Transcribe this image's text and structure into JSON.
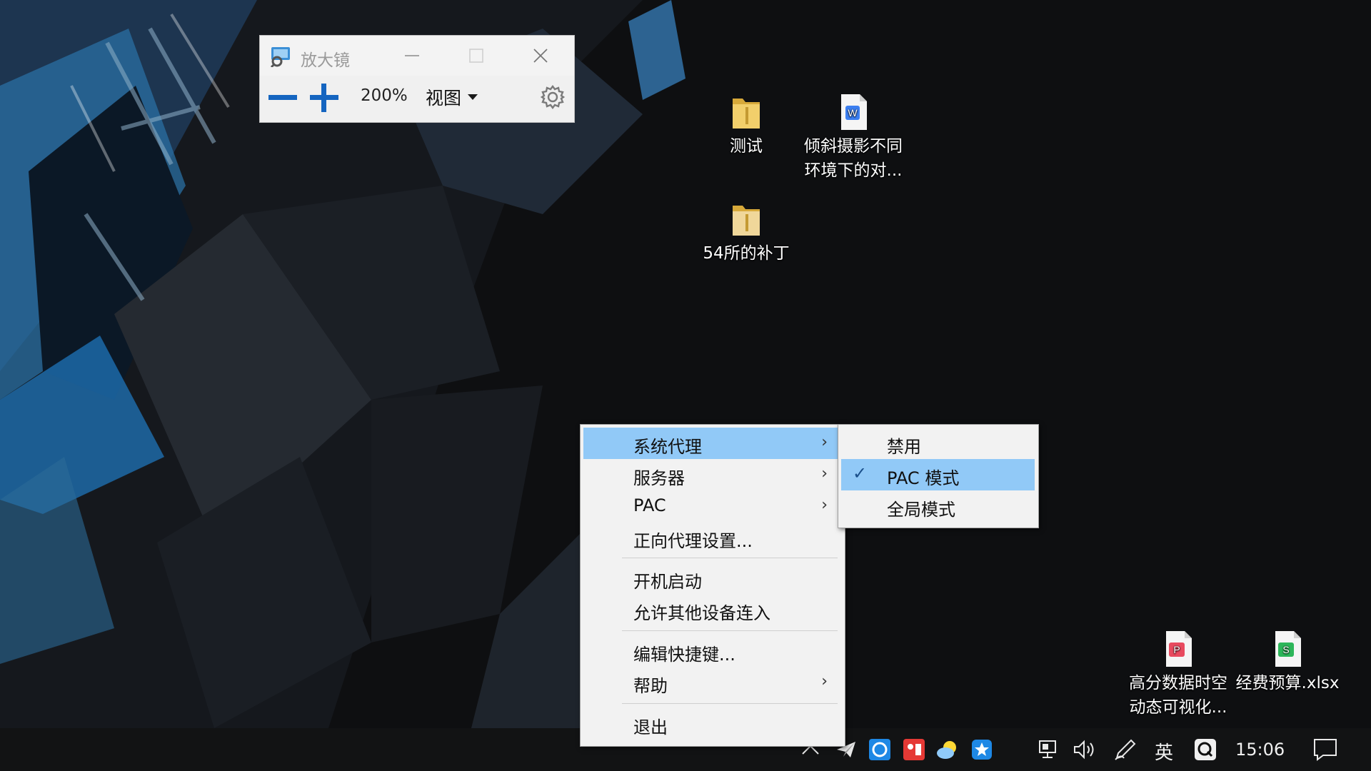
{
  "magnifier": {
    "title": "放大镜",
    "zoom": "200%",
    "view_label": "视图",
    "icons": [
      "magnifier-app-icon",
      "minimize-icon",
      "maximize-icon",
      "close-icon",
      "zoom-out-icon",
      "zoom-in-icon",
      "dropdown-arrow-icon",
      "gear-icon"
    ]
  },
  "desktop_icons": [
    {
      "label_lines": [
        "测试"
      ],
      "icon": "folder-icon"
    },
    {
      "label_lines": [
        "倾斜摄影不同",
        "环境下的对..."
      ],
      "icon": "word-doc-icon"
    },
    {
      "label_lines": [
        "54所的补丁"
      ],
      "icon": "folder-icon"
    },
    {
      "label_lines": [
        "高分数据时空",
        "动态可视化..."
      ],
      "icon": "pdf-file-icon"
    },
    {
      "label_lines": [
        "经费预算.xlsx"
      ],
      "icon": "spreadsheet-icon"
    }
  ],
  "context_menu": {
    "items": [
      {
        "label": "系统代理",
        "submenu": true,
        "highlighted": true
      },
      {
        "label": "服务器",
        "submenu": true
      },
      {
        "label": "PAC",
        "submenu": true
      },
      {
        "label": "正向代理设置..."
      },
      {
        "label": "开机启动"
      },
      {
        "label": "允许其他设备连入"
      },
      {
        "label": "编辑快捷键..."
      },
      {
        "label": "帮助",
        "submenu": true
      },
      {
        "label": "退出"
      }
    ],
    "arrow_glyph": "›"
  },
  "submenu": {
    "items": [
      {
        "label": "禁用"
      },
      {
        "label": "PAC 模式",
        "checked": true,
        "highlighted": true
      },
      {
        "label": "全局模式"
      }
    ],
    "check_glyph": "✓"
  },
  "taskbar": {
    "ime": "英",
    "time": "15:06",
    "tray_icons": [
      "show-hidden-icons-chevron-icon",
      "paper-plane-proxy-icon",
      "feedback-app-icon",
      "red-app-icon",
      "weather-app-icon",
      "blue-star-app-icon",
      "network-icon",
      "volume-icon",
      "pen-icon",
      "q-app-icon",
      "action-center-icon"
    ]
  },
  "colors": {
    "menu_highlight": "#91c9f7",
    "menu_bg": "#f2f2f2",
    "taskbar_bg": "#121314",
    "accent_blue": "#1565c0"
  }
}
